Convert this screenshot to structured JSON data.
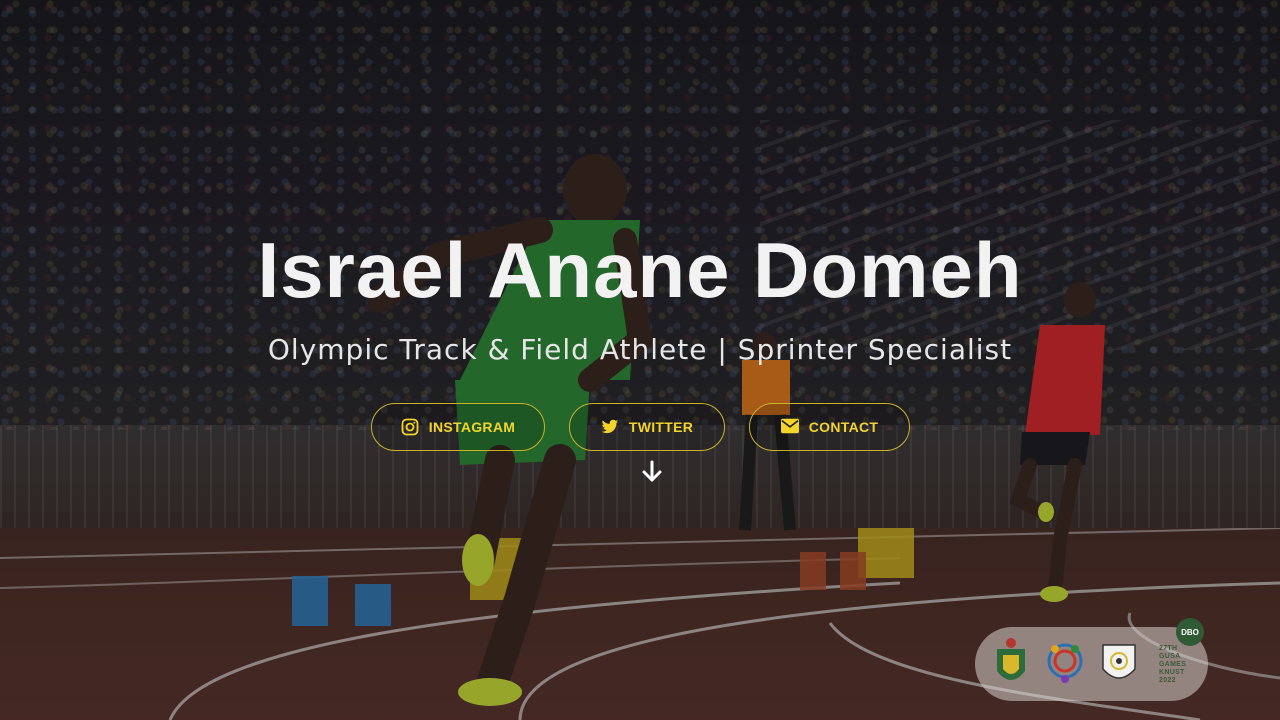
{
  "hero": {
    "name": "Israel Anane Domeh",
    "subtitle": "Olympic Track & Field Athlete | Sprinter Specialist",
    "background_icon": "stadium-sprint-photo"
  },
  "social_buttons": [
    {
      "label": "INSTAGRAM",
      "icon": "instagram-icon"
    },
    {
      "label": "TWITTER",
      "icon": "twitter-icon"
    },
    {
      "label": "CONTACT",
      "icon": "envelope-icon"
    }
  ],
  "scroll_down": {
    "icon": "arrow-down-icon"
  },
  "sponsor_logos": {
    "logos": [
      "knust-crest-logo",
      "knust-2022-logo",
      "gusa-logo",
      "gusa-games-logo"
    ],
    "games_text": "27TH GUSA GAMES KNUST 2022",
    "badge_text": "DBO"
  },
  "colors": {
    "accent": "#f3d42a",
    "button_border": "#c9b22a",
    "title_text": "#f2f2f2",
    "overlay": "#000000"
  }
}
